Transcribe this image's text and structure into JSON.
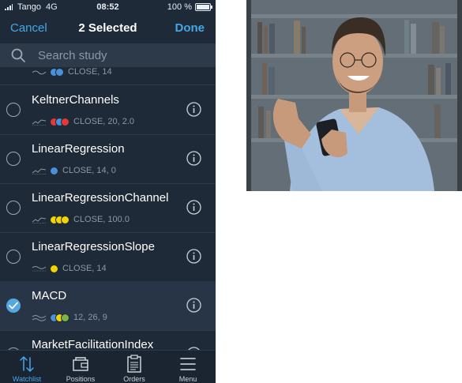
{
  "status_bar": {
    "carrier": "Tango",
    "network": "4G",
    "time": "08:52",
    "battery": "100 %"
  },
  "nav": {
    "cancel_label": "Cancel",
    "title": "2 Selected",
    "done_label": "Done"
  },
  "search": {
    "placeholder": "Search study",
    "value": ""
  },
  "studies": {
    "partial_top": {
      "params": "CLOSE, 14",
      "colors": [
        "#4a90d9",
        "#4a90d9"
      ]
    },
    "items": [
      {
        "name": "KeltnerChannels",
        "params": "CLOSE, 20, 2.0",
        "colors": [
          "#e53935",
          "#4a90d9",
          "#e53935"
        ],
        "selected": false
      },
      {
        "name": "LinearRegression",
        "params": "CLOSE, 14, 0",
        "colors": [
          "#4a90d9"
        ],
        "selected": false
      },
      {
        "name": "LinearRegressionChannel",
        "params": "CLOSE, 100.0",
        "colors": [
          "#f2d400",
          "#f2d400",
          "#f2d400"
        ],
        "selected": false
      },
      {
        "name": "LinearRegressionSlope",
        "params": "CLOSE, 14",
        "colors": [
          "#f2d400"
        ],
        "selected": false
      },
      {
        "name": "MACD",
        "params": "12, 26, 9",
        "colors": [
          "#4a90d9",
          "#f2d400",
          "#7cb342"
        ],
        "selected": true
      },
      {
        "name": "MarketFacilitationIndex",
        "params": "",
        "colors": [],
        "selected": false
      }
    ]
  },
  "tabs": [
    {
      "label": "Watchlist",
      "icon": "watchlist-icon",
      "active": true
    },
    {
      "label": "Positions",
      "icon": "wallet-icon",
      "active": false
    },
    {
      "label": "Orders",
      "icon": "clipboard-icon",
      "active": false
    },
    {
      "label": "Menu",
      "icon": "hamburger-icon",
      "active": false
    }
  ],
  "colors": {
    "accent": "#46a7e8",
    "background": "#1f2a38",
    "selected_check": "#55a7e0"
  }
}
